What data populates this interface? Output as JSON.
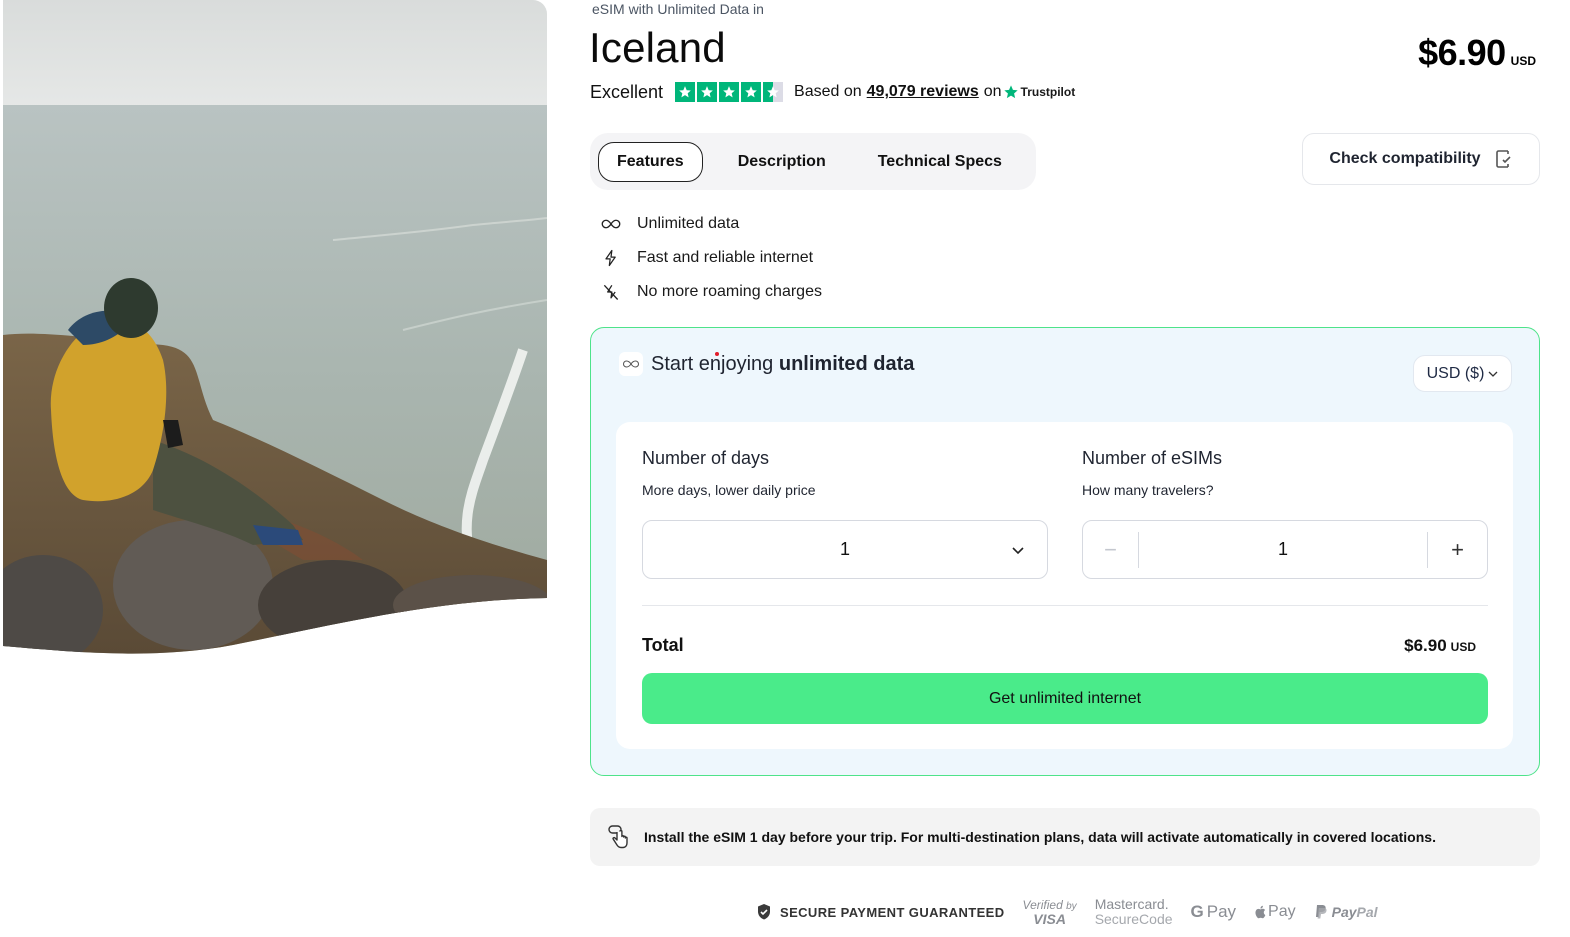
{
  "hero": {
    "image_alt": "Traveler in yellow jacket sitting on a cliff above the sea, looking at a phone"
  },
  "product": {
    "eyebrow": "eSIM with Unlimited Data in",
    "title": "Iceland",
    "price": "$6.90",
    "price_currency": "USD"
  },
  "rating": {
    "label": "Excellent",
    "stars": 4.5,
    "stars_max": 5,
    "based_on": "Based on",
    "reviews_link": "49,079 reviews",
    "on": "on",
    "provider": "Trustpilot",
    "star_color": "#00b67a"
  },
  "tabs": [
    {
      "label": "Features",
      "active": true
    },
    {
      "label": "Description",
      "active": false
    },
    {
      "label": "Technical Specs",
      "active": false
    }
  ],
  "compat_button": {
    "label": "Check compatibility",
    "icon": "phone-check-icon"
  },
  "features": [
    {
      "icon": "infinity-icon",
      "text": "Unlimited data"
    },
    {
      "icon": "lightning-icon",
      "text": "Fast and reliable internet"
    },
    {
      "icon": "no-roaming-icon",
      "text": "No more roaming charges"
    }
  ],
  "plan": {
    "title_prefix": "Start enjoying ",
    "title_bold": "unlimited data",
    "currency_select": "USD ($)",
    "days": {
      "label": "Number of days",
      "sublabel": "More days, lower daily price",
      "value": "1"
    },
    "esims": {
      "label": "Number of eSIMs",
      "sublabel": "How many travelers?",
      "value": "1",
      "minus": "−",
      "plus": "+"
    },
    "total_label": "Total",
    "total_amount": "$6.90",
    "total_currency": "USD",
    "cta": "Get unlimited internet",
    "accent_color": "#4aeb8a",
    "border_color": "#4ee38a",
    "background_color": "#eef7fd"
  },
  "install_note": {
    "text": "Install the eSIM 1 day before your trip. For multi-destination plans, data will activate automatically in covered locations."
  },
  "payment": {
    "secure_label": "SECURE PAYMENT GUARANTEED",
    "visa_top": "Verified",
    "visa_by": "by",
    "visa_bottom": "VISA",
    "mc_top": "Mastercard.",
    "mc_bottom": "SecureCode",
    "gpay_g": "G",
    "gpay": "Pay",
    "applepay": "Pay",
    "paypal_pay": "Pay",
    "paypal_pal": "Pal"
  }
}
